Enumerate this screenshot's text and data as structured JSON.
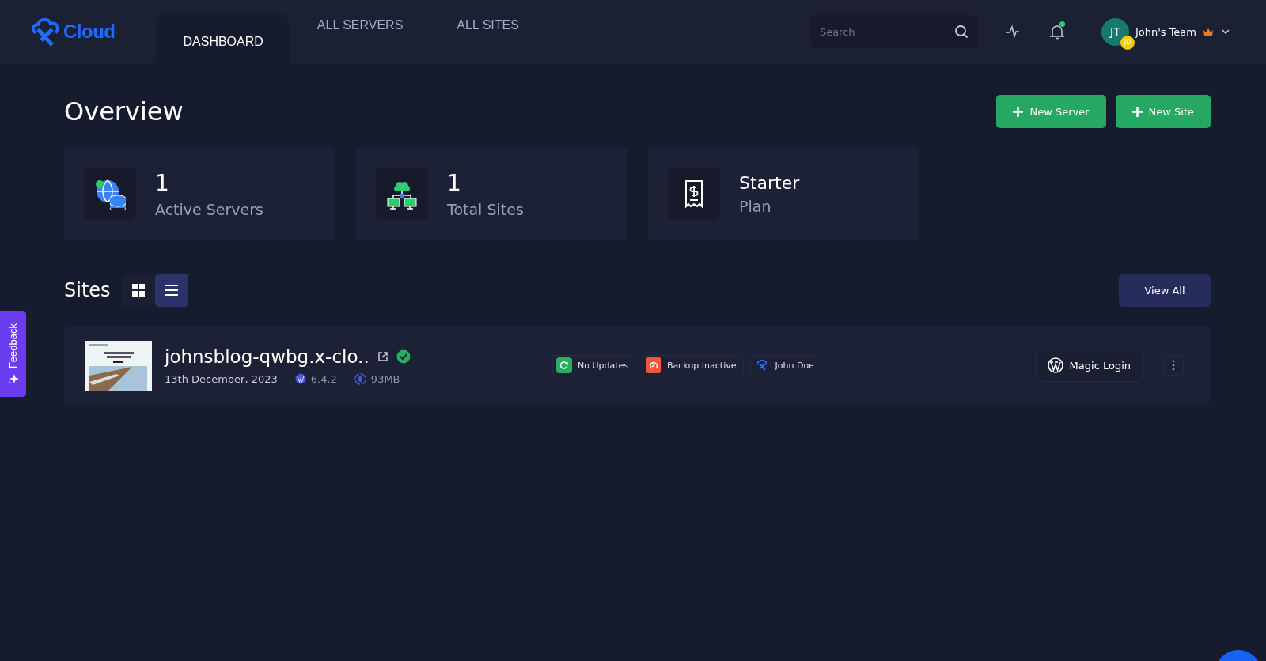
{
  "header": {
    "logo": "Cloud",
    "tabs": [
      {
        "label": "DASHBOARD",
        "selected": true
      },
      {
        "label": "ALL SERVERS",
        "selected": false
      },
      {
        "label": "ALL SITES",
        "selected": false
      }
    ],
    "search": {
      "placeholder": "Search"
    },
    "notifications": {
      "unread": true
    },
    "user": {
      "initials": "JT",
      "badge": "JD",
      "team": "John's Team",
      "owner": true
    }
  },
  "overview": {
    "title": "Overview",
    "buttons": [
      "New Server",
      "New Site"
    ],
    "stats": [
      {
        "kind": "servers",
        "value": "1",
        "label": "Active Servers"
      },
      {
        "kind": "sites",
        "value": "1",
        "label": "Total Sites"
      },
      {
        "kind": "plan",
        "value": "Starter",
        "label": "Plan"
      }
    ]
  },
  "sites": {
    "title": "Sites",
    "views": [
      {
        "kind": "grid",
        "selected": false
      },
      {
        "kind": "list",
        "selected": true
      }
    ],
    "view_all": "View All",
    "rows": [
      {
        "name": "johnsblog-qwbg.x-clo..",
        "verified": true,
        "date": "13th December, 2023",
        "wp_version": "6.4.2",
        "size": "93MB",
        "tags": [
          {
            "kind": "updates",
            "label": "No Updates"
          },
          {
            "kind": "backup",
            "label": "Backup Inactive"
          },
          {
            "kind": "user",
            "label": "John Doe"
          }
        ],
        "magic_login": "Magic Login"
      }
    ]
  },
  "feedback": "Feedback"
}
